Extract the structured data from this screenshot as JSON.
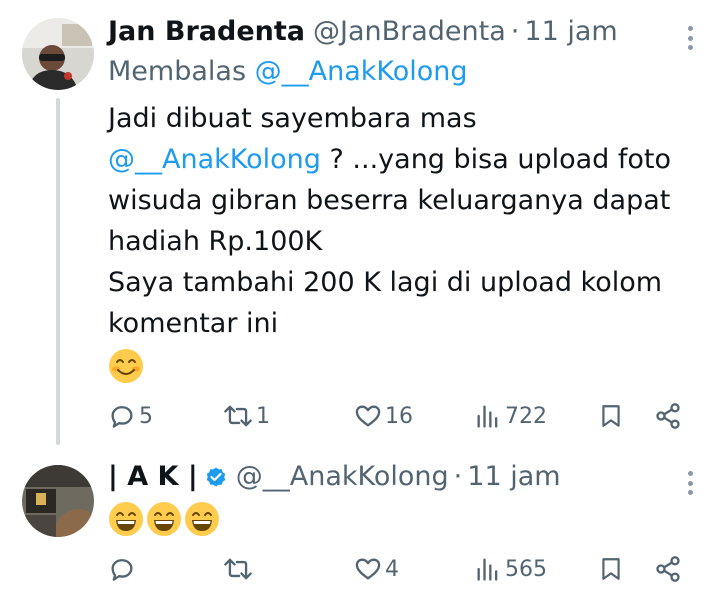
{
  "tweets": [
    {
      "author": {
        "name": "Jan Bradenta",
        "handle": "@JanBradenta",
        "time": "11 jam"
      },
      "reply_prefix": "Membalas",
      "reply_to": "@__AnakKolong",
      "body": {
        "line1": "Jadi dibuat sayembara mas",
        "line2_mention": "@__AnakKolong",
        "line2_rest": " ? ...yang bisa upload foto",
        "line3": "wisuda gibran beserra keluarganya dapat",
        "line4": "hadiah  Rp.100K",
        "line5": "Saya tambahi 200 K lagi di upload kolom",
        "line6": "komentar ini"
      },
      "emojis": [
        "smiling-face-with-smiling-eyes"
      ],
      "stats": {
        "replies": "5",
        "retweets": "1",
        "likes": "16",
        "views": "722"
      }
    },
    {
      "author": {
        "name": "| A K |",
        "verified": true,
        "handle": "@__AnakKolong",
        "time": "11 jam"
      },
      "emojis": [
        "grinning-face-with-smiling-eyes",
        "grinning-face-with-smiling-eyes",
        "grinning-face-with-smiling-eyes"
      ],
      "stats": {
        "replies": "",
        "retweets": "",
        "likes": "4",
        "views": "565"
      }
    }
  ],
  "separator": "·",
  "colors": {
    "link": "#1d9bf0",
    "muted": "#536471",
    "text": "#0f1419",
    "verified": "#1d9bf0"
  },
  "icons": [
    "reply-icon",
    "retweet-icon",
    "like-icon",
    "views-icon",
    "bookmark-icon",
    "share-icon",
    "more-icon",
    "verified-icon"
  ]
}
